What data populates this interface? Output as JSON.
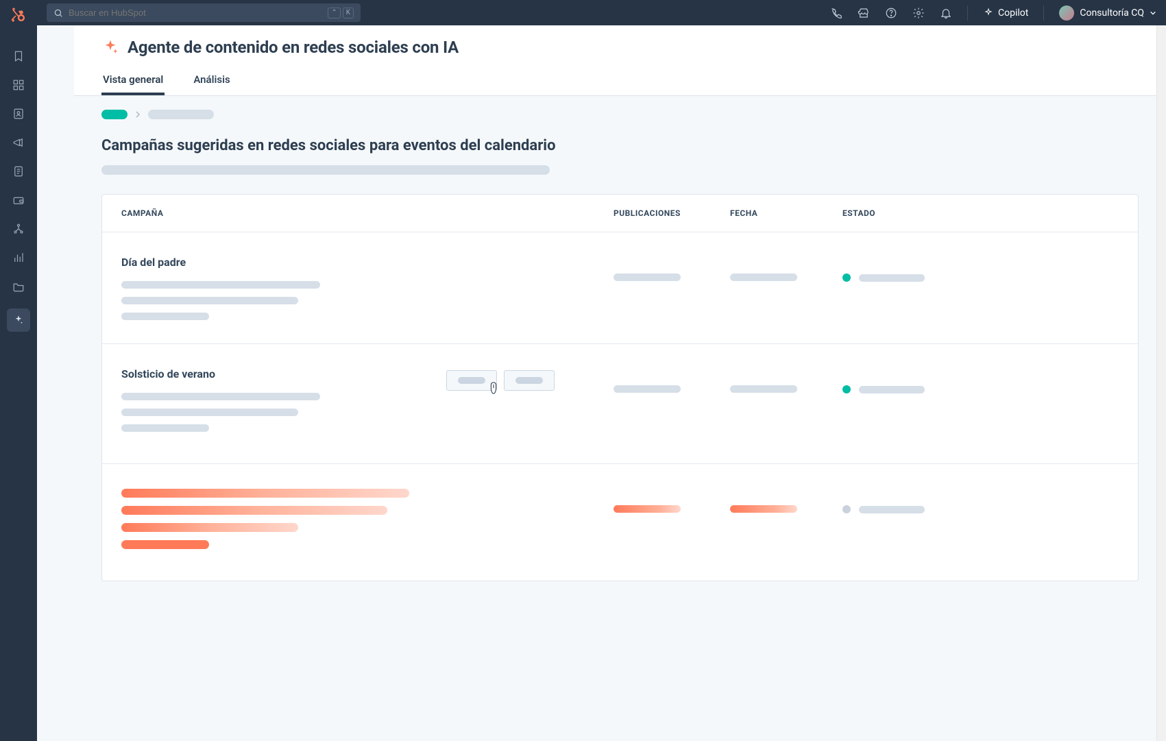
{
  "search": {
    "placeholder": "Buscar en HubSpot",
    "shortcut1": "⌃",
    "shortcut2": "K"
  },
  "copilot": {
    "label": "Copilot"
  },
  "account": {
    "name": "Consultoría CQ"
  },
  "page": {
    "title": "Agente de contenido en redes sociales con IA"
  },
  "tabs": {
    "overview": "Vista general",
    "analytics": "Análisis"
  },
  "section": {
    "title": "Campañas sugeridas en redes sociales para eventos del calendario"
  },
  "table": {
    "headers": {
      "campaign": "CAMPAÑA",
      "posts": "PUBLICACIONES",
      "date": "FECHA",
      "status": "ESTADO"
    },
    "rows": [
      {
        "title": "Día del padre"
      },
      {
        "title": "Solsticio de verano"
      },
      {
        "title": ""
      }
    ]
  }
}
